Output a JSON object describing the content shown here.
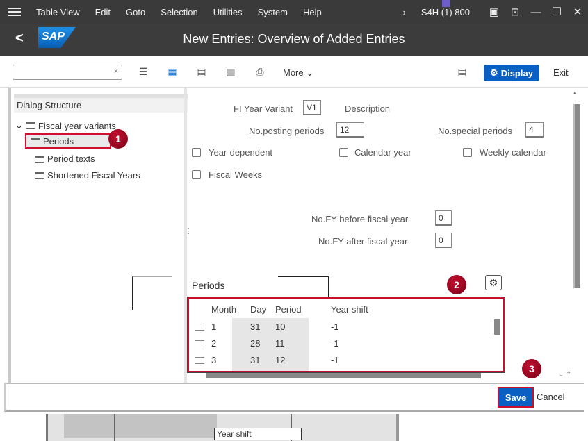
{
  "menubar": {
    "items": [
      "Table View",
      "Edit",
      "Goto",
      "Selection",
      "Utilities",
      "System",
      "Help"
    ],
    "system_info": "S4H (1) 800"
  },
  "titlebar": {
    "back": "<",
    "logo": "SAP",
    "title": "New Entries: Overview of Added Entries"
  },
  "toolbar": {
    "command_field_value": "",
    "more_label": "More",
    "display_label": "Display",
    "exit_label": "Exit"
  },
  "dialog_structure": {
    "title": "Dialog Structure",
    "items": [
      {
        "label": "Fiscal year variants",
        "level": 0,
        "selected": false
      },
      {
        "label": "Periods",
        "level": 1,
        "selected": true
      },
      {
        "label": "Period texts",
        "level": 1,
        "selected": false
      },
      {
        "label": "Shortened Fiscal Years",
        "level": 1,
        "selected": false
      }
    ]
  },
  "form": {
    "fy_variant_label": "FI Year Variant",
    "fy_variant_value": "V1",
    "description_label": "Description",
    "posting_periods_label": "No.posting periods",
    "posting_periods_value": "12",
    "special_periods_label": "No.special periods",
    "special_periods_value": "4",
    "year_dependent_label": "Year-dependent",
    "calendar_year_label": "Calendar year",
    "weekly_calendar_label": "Weekly calendar",
    "fiscal_weeks_label": "Fiscal Weeks",
    "fy_before_label": "No.FY before fiscal year",
    "fy_before_value": "0",
    "fy_after_label": "No.FY after fiscal year",
    "fy_after_value": "0"
  },
  "periods": {
    "title": "Periods",
    "columns": [
      "Month",
      "Day",
      "Period",
      "Year shift"
    ],
    "rows": [
      {
        "month": "1",
        "day": "31",
        "period": "10",
        "year_shift": "-1"
      },
      {
        "month": "2",
        "day": "28",
        "period": "11",
        "year_shift": "-1"
      },
      {
        "month": "3",
        "day": "31",
        "period": "12",
        "year_shift": "-1"
      }
    ]
  },
  "callouts": [
    "1",
    "2",
    "3"
  ],
  "footer": {
    "save_label": "Save",
    "cancel_label": "Cancel"
  },
  "underlay": {
    "field_label": "Year shift"
  },
  "colors": {
    "accent": "#0a5fc2",
    "highlight": "#c8102e",
    "header_bg": "#3c3c3c"
  }
}
